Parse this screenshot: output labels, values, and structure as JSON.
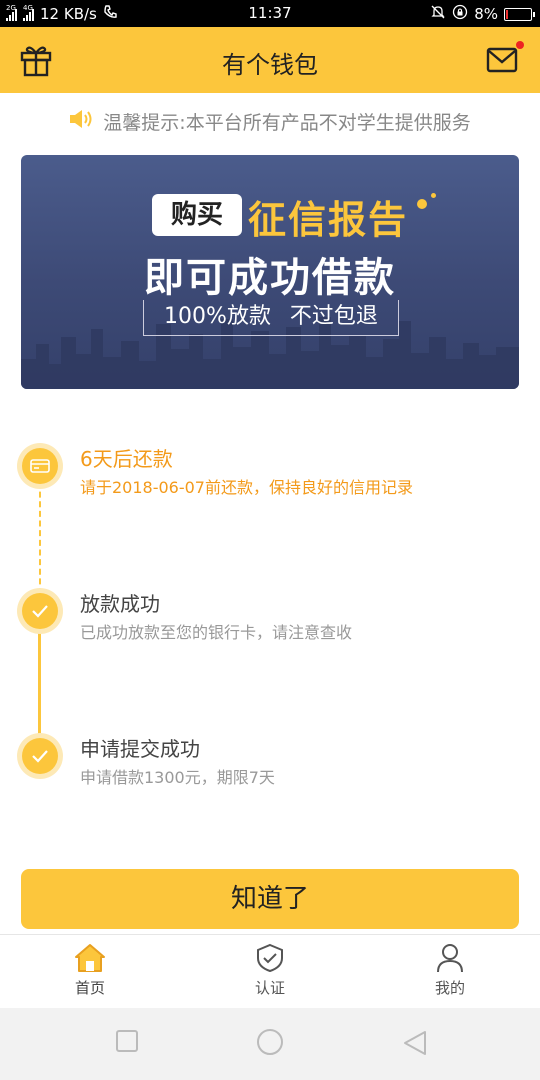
{
  "status_bar": {
    "net1": "2G",
    "net2": "4G",
    "speed": "12 KB/s",
    "time": "11:37",
    "battery": "8%",
    "battery_level": 0.08
  },
  "header": {
    "title": "有个钱包",
    "left_icon": "gift-icon",
    "right_icon": "mail-icon",
    "has_unread": true
  },
  "notice": {
    "icon": "speaker-icon",
    "text": "温馨提示:本平台所有产品不对学生提供服务"
  },
  "banner": {
    "buy": "购买",
    "report": "征信报告",
    "main": "即可成功借款",
    "sub": "100%放款 不过包退",
    "colors": {
      "accent": "#fcc63c",
      "background": "#3d4a76"
    }
  },
  "timeline": [
    {
      "title": "6天后还款",
      "desc": "请于2018-06-07前还款，保持良好的信用记录",
      "state": "pending",
      "icon": "card-icon",
      "color": "#f39a1a"
    },
    {
      "title": "放款成功",
      "desc": "已成功放款至您的银行卡，请注意查收",
      "state": "done",
      "icon": "check-icon"
    },
    {
      "title": "申请提交成功",
      "desc": "申请借款1300元，期限7天",
      "state": "done",
      "icon": "check-icon"
    }
  ],
  "button": {
    "label": "知道了"
  },
  "tabs": [
    {
      "label": "首页",
      "icon": "home-icon",
      "active": true
    },
    {
      "label": "认证",
      "icon": "shield-check-icon",
      "active": false
    },
    {
      "label": "我的",
      "icon": "person-icon",
      "active": false
    }
  ],
  "nav": {
    "icons": [
      "square-icon",
      "circle-icon",
      "back-triangle-icon"
    ]
  },
  "colors": {
    "primary": "#fcc63c",
    "orange_text": "#f39a1a",
    "gray_text": "#888888"
  }
}
